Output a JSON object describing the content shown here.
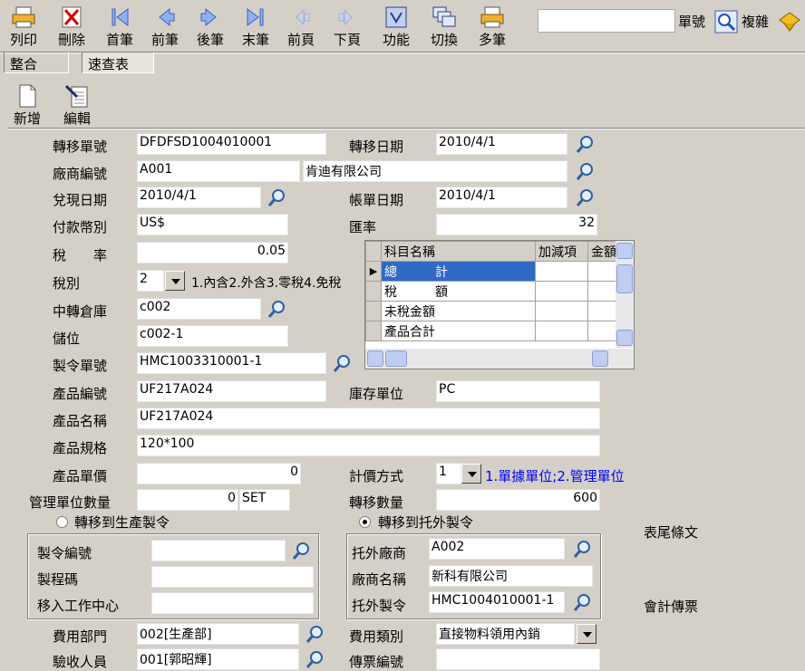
{
  "toolbar": {
    "print": "列印",
    "delete": "刪除",
    "first": "首筆",
    "prev": "前筆",
    "next": "後筆",
    "last": "末筆",
    "prev_page": "前頁",
    "next_page": "下頁",
    "function": "功能",
    "switch": "切換",
    "multi": "多筆",
    "doc_no_label": "單號",
    "complex_label": "複雜",
    "search_value": ""
  },
  "tabs": {
    "merge": "整合",
    "quick": "速查表"
  },
  "subtoolbar": {
    "new": "新增",
    "edit": "編輯"
  },
  "form": {
    "transfer_no_label": "轉移單號",
    "transfer_no": "DFDFSD1004010001",
    "transfer_date_label": "轉移日期",
    "transfer_date": "2010/4/1",
    "vendor_no_label": "廠商編號",
    "vendor_no": "A001",
    "vendor_name": "肯迪有限公司",
    "cash_date_label": "兌現日期",
    "cash_date": "2010/4/1",
    "bill_date_label": "帳單日期",
    "bill_date": "2010/4/1",
    "currency_label": "付款幣別",
    "currency": "US$",
    "rate_label": "匯率",
    "rate": "32",
    "tax_rate_label": "稅　　率",
    "tax_rate": "0.05",
    "tax_type_label": "稅別",
    "tax_type": "2",
    "tax_type_hint": "1.內含2.外含3.零稅4.免稅",
    "warehouse_label": "中轉倉庫",
    "warehouse": "c002",
    "location_label": "儲位",
    "location": "c002-1",
    "mo_no_label": "製令單號",
    "mo_no": "HMC1003310001-1",
    "product_no_label": "產品編號",
    "product_no": "UF217A024",
    "stock_unit_label": "庫存單位",
    "stock_unit": "PC",
    "product_name_label": "產品名稱",
    "product_name": "UF217A024",
    "product_spec_label": "產品規格",
    "product_spec": "120*100",
    "unit_price_label": "產品單價",
    "unit_price": "0",
    "pricing_label": "計價方式",
    "pricing": "1",
    "pricing_hint": "1.單據單位;2.管理單位",
    "mgmt_qty_label": "管理單位數量",
    "mgmt_qty": "0",
    "mgmt_unit": "SET",
    "transfer_qty_label": "轉移數量",
    "transfer_qty": "600",
    "radio_prod": "轉移到生產製令",
    "radio_outs": "轉移到托外製令",
    "mo_code_label": "製令編號",
    "mo_code": "",
    "process_label": "製程碼",
    "process": "",
    "workcenter_label": "移入工作中心",
    "workcenter": "",
    "outs_vendor_label": "托外廠商",
    "outs_vendor": "A002",
    "outs_vendor_name_label": "廠商名稱",
    "outs_vendor_name": "新科有限公司",
    "outs_mo_label": "托外製令",
    "outs_mo": "HMC1004010001-1",
    "footer_text": "表尾條文",
    "acct_voucher": "會計傳票",
    "expense_dept_label": "費用部門",
    "expense_dept": "002[生產部]",
    "expense_type_label": "費用類別",
    "expense_type": "直接物料領用內銷",
    "inspector_label": "驗收人員",
    "inspector": "001[郭昭輝]",
    "voucher_no_label": "傳票編號",
    "voucher_no": ""
  },
  "grid": {
    "headers": [
      "科目名稱",
      "加減項",
      "金額"
    ],
    "rows": [
      {
        "name": "總　　　計"
      },
      {
        "name": "稅　　　額"
      },
      {
        "name": "未稅金額"
      },
      {
        "name": "產品合計"
      }
    ]
  }
}
